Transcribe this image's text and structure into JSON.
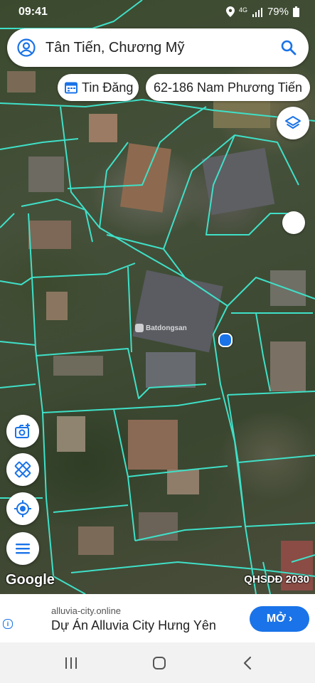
{
  "status_bar": {
    "time": "09:41",
    "network": "4G",
    "battery": "79%",
    "icons": [
      "location-icon",
      "signal-icon",
      "battery-icon"
    ]
  },
  "search": {
    "query": "Tân Tiến, Chương Mỹ",
    "icons": [
      "account-icon",
      "search-icon"
    ]
  },
  "chips": {
    "listing_label": "Tin Đăng",
    "address_label": "62-186 Nam Phương Tiến"
  },
  "map": {
    "watermark": "Batdongsan",
    "attribution": "Google",
    "layer_label": "QHSDĐ 2030",
    "line_color": "#3fe0c8",
    "location_color": "#1a73e8"
  },
  "tools": [
    "camera-add-icon",
    "measure-ruler-icon",
    "my-location-icon",
    "menu-icon",
    "layers-icon"
  ],
  "ad": {
    "domain": "alluvia-city.online",
    "title": "Dự Án Alluvia City Hưng Yên",
    "button_label": "MỞ",
    "accent": "#1a73e8"
  },
  "nav": {
    "icons": [
      "recent-apps-icon",
      "home-icon",
      "back-icon"
    ]
  }
}
